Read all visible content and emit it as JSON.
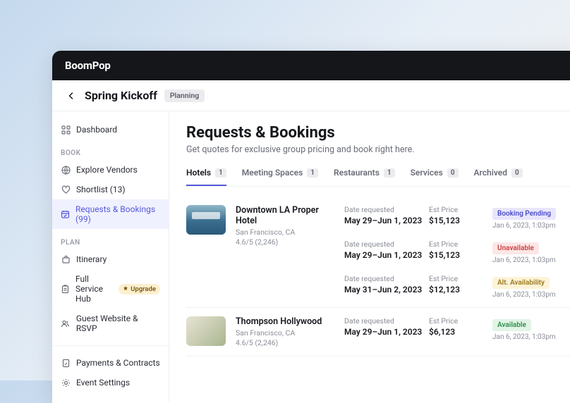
{
  "brand": "BoomPop",
  "header": {
    "event_title": "Spring Kickoff",
    "status": "Planning"
  },
  "sidebar": {
    "items": [
      {
        "label": "Dashboard"
      }
    ],
    "section_book": "BOOK",
    "book_items": [
      {
        "label": "Explore Vendors"
      },
      {
        "label": "Shortlist (13)"
      },
      {
        "label": "Requests & Bookings (99)"
      }
    ],
    "section_plan": "PLAN",
    "plan_items": [
      {
        "label": "Itinerary"
      },
      {
        "label": "Full Service Hub",
        "upgrade": "Upgrade"
      },
      {
        "label": "Guest Website & RSVP"
      }
    ],
    "other_items": [
      {
        "label": "Payments & Contracts"
      },
      {
        "label": "Event Settings"
      }
    ]
  },
  "page": {
    "title": "Requests & Bookings",
    "subtitle": "Get quotes for exclusive group pricing and book right here."
  },
  "tabs": [
    {
      "label": "Hotels",
      "count": "1"
    },
    {
      "label": "Meeting Spaces",
      "count": "1"
    },
    {
      "label": "Restaurants",
      "count": "1"
    },
    {
      "label": "Services",
      "count": "0"
    },
    {
      "label": "Archived",
      "count": "0"
    }
  ],
  "labels": {
    "date_requested": "Date requested",
    "est_price": "Est Price"
  },
  "bookings": [
    {
      "name": "Downtown LA Proper Hotel",
      "location": "San Francisco, CA",
      "rating": "4.6/5 (2,246)",
      "quotes": [
        {
          "dates": "May 29–Jun 1, 2023",
          "price": "$15,123",
          "status": "Booking Pending",
          "status_class": "pending",
          "status_date": "Jan 6, 2023, 1:03pm"
        },
        {
          "dates": "May 29–Jun 1, 2023",
          "price": "$15,123",
          "status": "Unavailable",
          "status_class": "unavailable",
          "status_date": "Jan 6, 2023, 1:03pm"
        },
        {
          "dates": "May 31–Jun 2, 2023",
          "price": "$12,123",
          "status": "Alt. Availability",
          "status_class": "alt",
          "status_date": "Jan 6, 2023, 1:03pm"
        }
      ]
    },
    {
      "name": "Thompson Hollywood",
      "location": "San Francisco, CA",
      "rating": "4.6/5 (2,246)",
      "quotes": [
        {
          "dates": "May 29–Jun 1, 2023",
          "price": "$6,123",
          "status": "Available",
          "status_class": "available",
          "status_date": "Jan 6, 2023, 1:03pm"
        }
      ]
    }
  ]
}
